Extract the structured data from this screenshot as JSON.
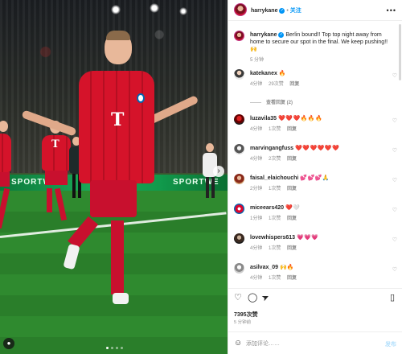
{
  "post": {
    "username": "harrykane",
    "follow_label": "关注",
    "caption": "Berlin bound!! Top top night away from home to secure our spot in the final. We keep pushing!! 🙌",
    "caption_time": "5 分钟",
    "likes": "7395次赞",
    "posted_ago": "5 分钟前"
  },
  "photo": {
    "adboard_left": "SPORTWE",
    "adboard_right": "SPORTWE",
    "slide_count": 4,
    "active_slide": 1
  },
  "comments": [
    {
      "user": "katekanex",
      "text": "🔥",
      "time": "4分钟",
      "likes": "29次赞",
      "reply": "回复",
      "avatar": "av-kate",
      "view_replies": "查看回复 (2)"
    },
    {
      "user": "luzavila35",
      "text": "❤️❤️❤️🔥🔥🔥",
      "time": "4分钟",
      "likes": "1次赞",
      "reply": "回复",
      "avatar": "av-luz"
    },
    {
      "user": "marvingangfuss",
      "text": "❤️❤️❤️❤️❤️❤️",
      "time": "4分钟",
      "likes": "2次赞",
      "reply": "回复",
      "avatar": "av-marv"
    },
    {
      "user": "faisal_elaichouchi",
      "text": "💕💕💕🙏",
      "time": "2分钟",
      "likes": "1次赞",
      "reply": "回复",
      "avatar": "av-fais"
    },
    {
      "user": "miceears420",
      "text": "❤️🤍",
      "time": "1分钟",
      "likes": "1次赞",
      "reply": "回复",
      "avatar": "av-mice"
    },
    {
      "user": "lovewhispers613",
      "text": "💗💗💗",
      "time": "4分钟",
      "likes": "1次赞",
      "reply": "回复",
      "avatar": "av-love"
    },
    {
      "user": "asilvax_09",
      "text": "🙌🔥",
      "time": "4分钟",
      "likes": "1次赞",
      "reply": "回复",
      "avatar": "av-asil"
    }
  ],
  "compose": {
    "placeholder": "添加评论……",
    "post_label": "发布"
  },
  "icons": {
    "heart": "♡",
    "comment": "◯",
    "share": "➤",
    "save": "▯",
    "emoji": "☺",
    "more": "•••"
  },
  "colors": {
    "accent": "#0095f6",
    "shirt_red": "#d5132a"
  }
}
